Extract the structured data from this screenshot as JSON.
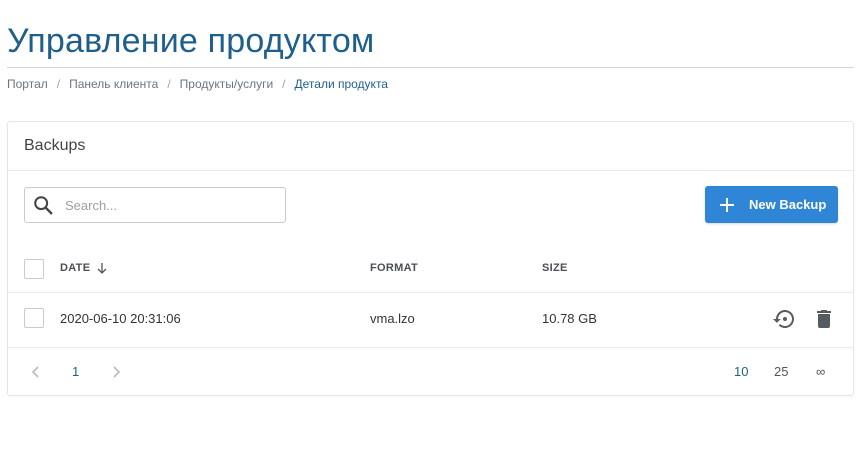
{
  "page": {
    "title": "Управление продуктом"
  },
  "breadcrumb": {
    "items": [
      "Портал",
      "Панель клиента",
      "Продукты/услуги",
      "Детали продукта"
    ],
    "separator": "/"
  },
  "card": {
    "title": "Backups",
    "search": {
      "placeholder": "Search...",
      "value": ""
    },
    "new_button_label": "New Backup",
    "columns": {
      "date": "DATE",
      "format": "FORMAT",
      "size": "SIZE"
    },
    "rows": [
      {
        "date": "2020-06-10 20:31:06",
        "format": "vma.lzo",
        "size": "10.78 GB"
      }
    ],
    "pagination": {
      "current_page": "1",
      "page_sizes": [
        "10",
        "25",
        "∞"
      ],
      "selected_page_size": "10"
    }
  },
  "colors": {
    "accent": "#2f86d6",
    "title": "#1f5f8b",
    "icon": "#555b61"
  }
}
